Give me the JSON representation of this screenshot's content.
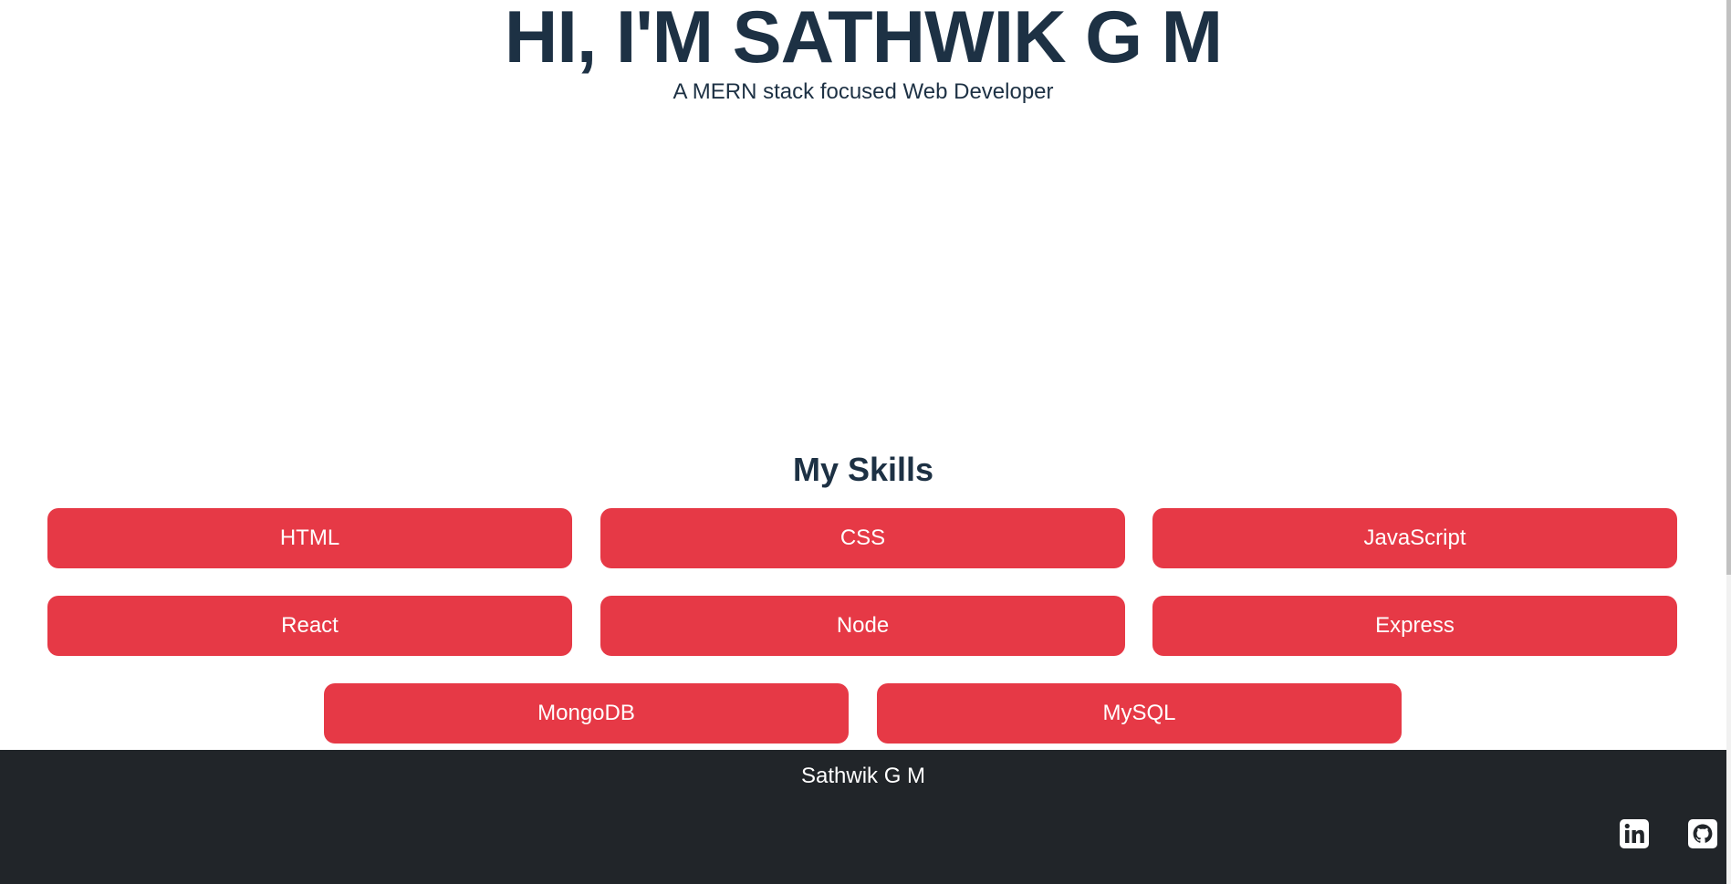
{
  "hero": {
    "title": "HI, I'M SATHWIK G M",
    "subtitle": "A MERN stack focused Web Developer"
  },
  "skills": {
    "heading": "My Skills",
    "items": [
      "HTML",
      "CSS",
      "JavaScript",
      "React",
      "Node",
      "Express",
      "MongoDB",
      "MySQL"
    ]
  },
  "footer": {
    "name": "Sathwik G M",
    "icons": [
      "linkedin-icon",
      "github-icon"
    ]
  },
  "colors": {
    "text": "#1d3144",
    "accent": "#e63946",
    "footer_bg": "#212529"
  }
}
